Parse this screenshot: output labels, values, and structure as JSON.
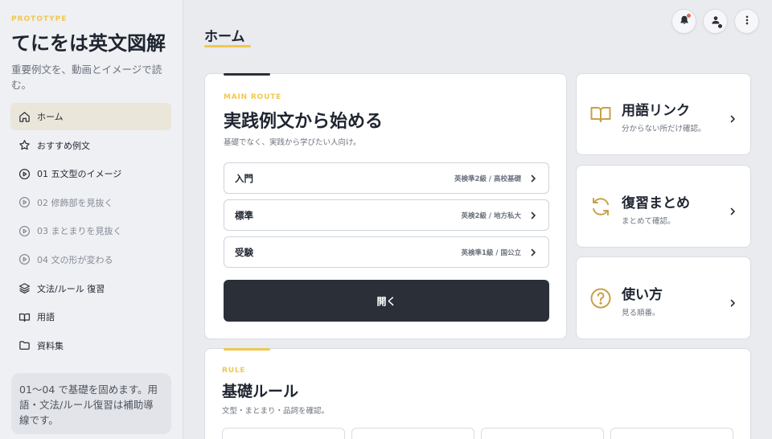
{
  "sidebar": {
    "brand_tag": "PROTOTYPE",
    "app_title": "てにをは英文図解",
    "app_subtitle": "重要例文を、動画とイメージで読む。",
    "nav": [
      {
        "label": "ホーム",
        "icon": "home-icon",
        "state": "active"
      },
      {
        "label": "おすすめ例文",
        "icon": "star-icon",
        "state": "normal"
      },
      {
        "label": "01 五文型のイメージ",
        "icon": "play-circle-icon",
        "state": "normal"
      },
      {
        "label": "02 修飾部を見抜く",
        "icon": "play-circle-icon",
        "state": "muted"
      },
      {
        "label": "03 まとまりを見抜く",
        "icon": "play-circle-icon",
        "state": "muted"
      },
      {
        "label": "04 文の形が変わる",
        "icon": "play-circle-icon",
        "state": "muted"
      },
      {
        "label": "文法/ルール 復習",
        "icon": "layers-icon",
        "state": "normal"
      },
      {
        "label": "用語",
        "icon": "book-icon",
        "state": "normal"
      },
      {
        "label": "資料集",
        "icon": "folder-icon",
        "state": "normal"
      }
    ],
    "note": "01〜04 で基礎を固めます。用語・文法/ルール復習は補助導線です。"
  },
  "header": {
    "title": "ホーム",
    "icons": [
      "bell-icon",
      "user-icon",
      "more-vertical-icon"
    ]
  },
  "main_route": {
    "eyebrow": "MAIN ROUTE",
    "heading": "実践例文から始める",
    "description": "基礎でなく、実践から学びたい人向け。",
    "routes": [
      {
        "label": "入門",
        "meta": "英検準2級 / 高校基礎"
      },
      {
        "label": "標準",
        "meta": "英検2級 / 地方私大"
      },
      {
        "label": "受験",
        "meta": "英検準1級 / 国公立"
      }
    ],
    "open_button": "開く"
  },
  "side_cards": [
    {
      "title": "用語リンク",
      "desc": "分からない所だけ確認。",
      "icon": "book-open-icon"
    },
    {
      "title": "復習まとめ",
      "desc": "まとめて確認。",
      "icon": "refresh-icon"
    },
    {
      "title": "使い方",
      "desc": "見る順番。",
      "icon": "help-circle-icon"
    }
  ],
  "rule": {
    "eyebrow": "RULE",
    "heading": "基礎ルール",
    "description": "文型・まとまり・品詞を確認。"
  },
  "colors": {
    "accent": "#f0c850",
    "dark": "#2b3038",
    "icon_gold": "#c9a04a",
    "background": "#e9ebef"
  }
}
